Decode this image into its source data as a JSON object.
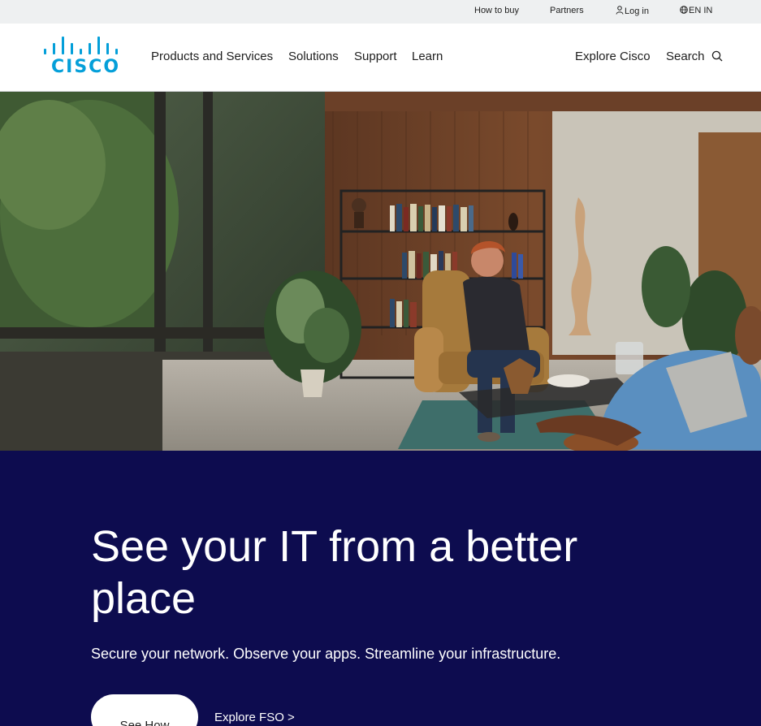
{
  "utility": {
    "how_to_buy": "How to buy",
    "partners": "Partners",
    "login": "Log in",
    "language": "EN IN"
  },
  "header": {
    "logo_text": "CISCO",
    "nav": [
      "Products and Services",
      "Solutions",
      "Support",
      "Learn"
    ],
    "explore": "Explore Cisco",
    "search": "Search"
  },
  "hero": {
    "title": "See your IT from a better place",
    "subtitle": "Secure your network. Observe your apps. Streamline your infrastructure.",
    "primary_cta": "See How",
    "secondary_cta": "Explore FSO >"
  },
  "colors": {
    "brand": "#049fd9",
    "hero_background": "#0d0c4f",
    "utility_bar": "#eef0f1"
  },
  "icons": {
    "login": "person-icon",
    "language": "globe-icon",
    "search": "search-icon"
  }
}
